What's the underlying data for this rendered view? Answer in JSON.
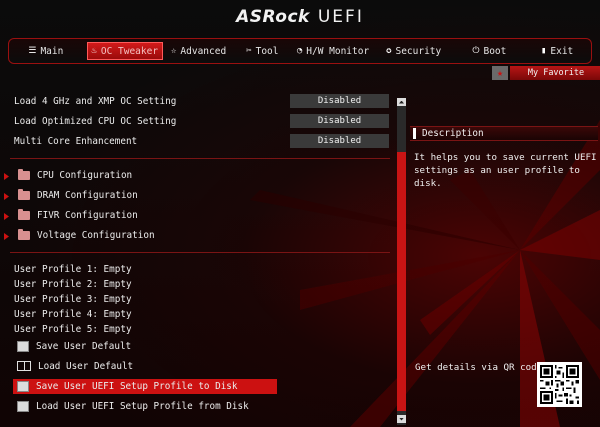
{
  "header": {
    "brand": "ASRock",
    "product": "UEFI"
  },
  "tabs": [
    {
      "label": "Main",
      "icon": "list-icon",
      "active": false
    },
    {
      "label": "OC Tweaker",
      "icon": "flame-icon",
      "active": true
    },
    {
      "label": "Advanced",
      "icon": "star-icon",
      "active": false
    },
    {
      "label": "Tool",
      "icon": "wrench-icon",
      "active": false
    },
    {
      "label": "H/W Monitor",
      "icon": "monitor-icon",
      "active": false
    },
    {
      "label": "Security",
      "icon": "shield-icon",
      "active": false
    },
    {
      "label": "Boot",
      "icon": "power-icon",
      "active": false
    },
    {
      "label": "Exit",
      "icon": "exit-icon",
      "active": false
    }
  ],
  "favorite": {
    "label": "My Favorite",
    "icon": "star-icon"
  },
  "settings": [
    {
      "label": "Load 4 GHz and XMP OC Setting",
      "value": "Disabled"
    },
    {
      "label": "Load Optimized CPU OC Setting",
      "value": "Disabled"
    },
    {
      "label": "Multi Core Enhancement",
      "value": "Disabled"
    }
  ],
  "submenus": [
    {
      "label": "CPU Configuration"
    },
    {
      "label": "DRAM Configuration"
    },
    {
      "label": "FIVR Configuration"
    },
    {
      "label": "Voltage Configuration"
    }
  ],
  "profiles": [
    {
      "label": "User Profile 1: Empty"
    },
    {
      "label": "User Profile 2: Empty"
    },
    {
      "label": "User Profile 3: Empty"
    },
    {
      "label": "User Profile 4: Empty"
    },
    {
      "label": "User Profile 5: Empty"
    }
  ],
  "actions": [
    {
      "label": "Save User Default",
      "icon": "save-icon"
    },
    {
      "label": "Load User Default",
      "icon": "book-icon"
    },
    {
      "label": "Save User UEFI Setup Profile to Disk",
      "icon": "disk-save-icon",
      "selected": true
    },
    {
      "label": "Load User UEFI Setup Profile from Disk",
      "icon": "disk-load-icon"
    }
  ],
  "description": {
    "title": "Description",
    "text": "It helps you to save current UEFI settings as an user profile to disk.",
    "qr_label": "Get details via QR code"
  },
  "colors": {
    "accent": "#cc1111",
    "value_bg": "#3a3a3a"
  }
}
